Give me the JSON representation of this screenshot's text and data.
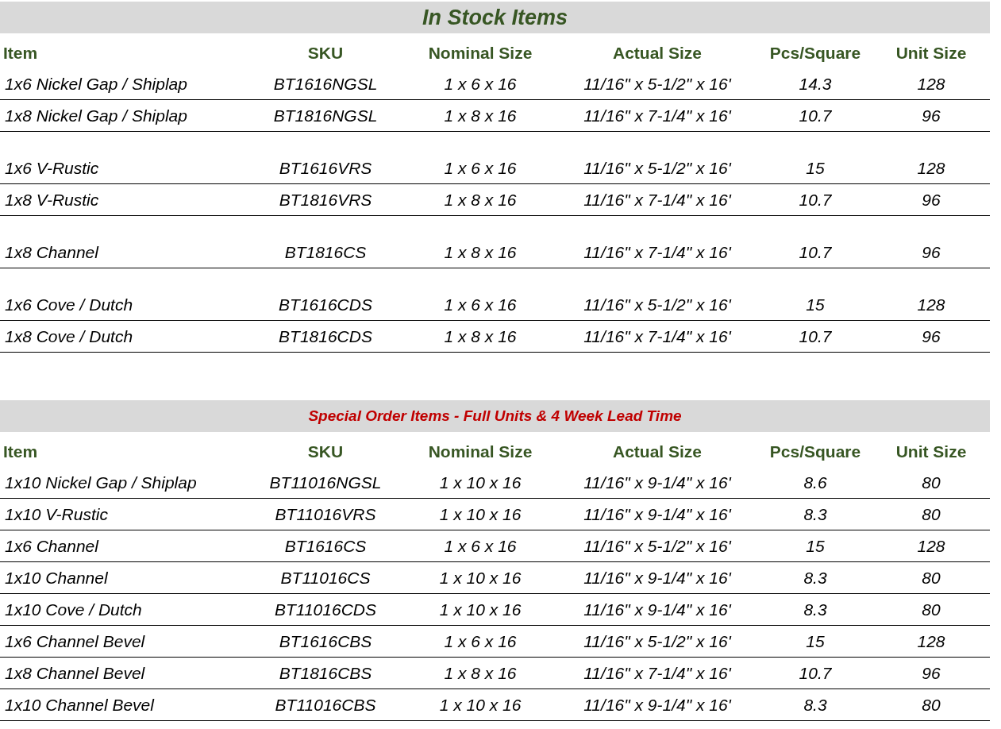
{
  "sections": [
    {
      "kind": "in_stock",
      "title": "In Stock Items",
      "columns": [
        "Item",
        "SKU",
        "Nominal Size",
        "Actual Size",
        "Pcs/Square",
        "Unit Size"
      ],
      "groups": [
        [
          [
            "1x6 Nickel Gap / Shiplap",
            "BT1616NGSL",
            "1 x 6 x 16",
            "11/16\" x 5-1/2\" x 16'",
            "14.3",
            "128"
          ],
          [
            "1x8 Nickel Gap / Shiplap",
            "BT1816NGSL",
            "1 x 8 x 16",
            "11/16\" x 7-1/4\" x 16'",
            "10.7",
            "96"
          ]
        ],
        [
          [
            "1x6 V-Rustic",
            "BT1616VRS",
            "1 x 6 x 16",
            "11/16\" x 5-1/2\" x 16'",
            "15",
            "128"
          ],
          [
            "1x8 V-Rustic",
            "BT1816VRS",
            "1 x 8 x 16",
            "11/16\" x 7-1/4\" x 16'",
            "10.7",
            "96"
          ]
        ],
        [
          [
            "1x8 Channel",
            "BT1816CS",
            "1 x 8 x 16",
            "11/16\" x 7-1/4\" x 16'",
            "10.7",
            "96"
          ]
        ],
        [
          [
            "1x6 Cove / Dutch",
            "BT1616CDS",
            "1 x 6 x 16",
            "11/16\" x 5-1/2\" x 16'",
            "15",
            "128"
          ],
          [
            "1x8 Cove / Dutch",
            "BT1816CDS",
            "1 x 8 x 16",
            "11/16\" x 7-1/4\" x 16'",
            "10.7",
            "96"
          ]
        ]
      ]
    },
    {
      "kind": "special_order",
      "title": "Special Order Items - Full Units & 4 Week Lead Time",
      "columns": [
        "Item",
        "SKU",
        "Nominal Size",
        "Actual Size",
        "Pcs/Square",
        "Unit Size"
      ],
      "groups": [
        [
          [
            "1x10 Nickel Gap / Shiplap",
            "BT11016NGSL",
            "1 x 10 x 16",
            "11/16\" x 9-1/4\" x 16'",
            "8.6",
            "80"
          ],
          [
            "1x10 V-Rustic",
            "BT11016VRS",
            "1 x 10 x 16",
            "11/16\" x 9-1/4\" x 16'",
            "8.3",
            "80"
          ],
          [
            "1x6 Channel",
            "BT1616CS",
            "1 x 6 x 16",
            "11/16\" x 5-1/2\" x 16'",
            "15",
            "128"
          ],
          [
            "1x10 Channel",
            "BT11016CS",
            "1 x 10 x 16",
            "11/16\" x 9-1/4\" x 16'",
            "8.3",
            "80"
          ],
          [
            "1x10 Cove / Dutch",
            "BT11016CDS",
            "1 x 10 x 16",
            "11/16\" x 9-1/4\" x 16'",
            "8.3",
            "80"
          ],
          [
            "1x6 Channel Bevel",
            "BT1616CBS",
            "1 x 6 x 16",
            "11/16\" x 5-1/2\" x 16'",
            "15",
            "128"
          ],
          [
            "1x8 Channel Bevel",
            "BT1816CBS",
            "1 x 8 x 16",
            "11/16\" x 7-1/4\" x 16'",
            "10.7",
            "96"
          ],
          [
            "1x10 Channel Bevel",
            "BT11016CBS",
            "1 x 10 x 16",
            "11/16\" x 9-1/4\" x 16'",
            "8.3",
            "80"
          ]
        ]
      ]
    }
  ]
}
